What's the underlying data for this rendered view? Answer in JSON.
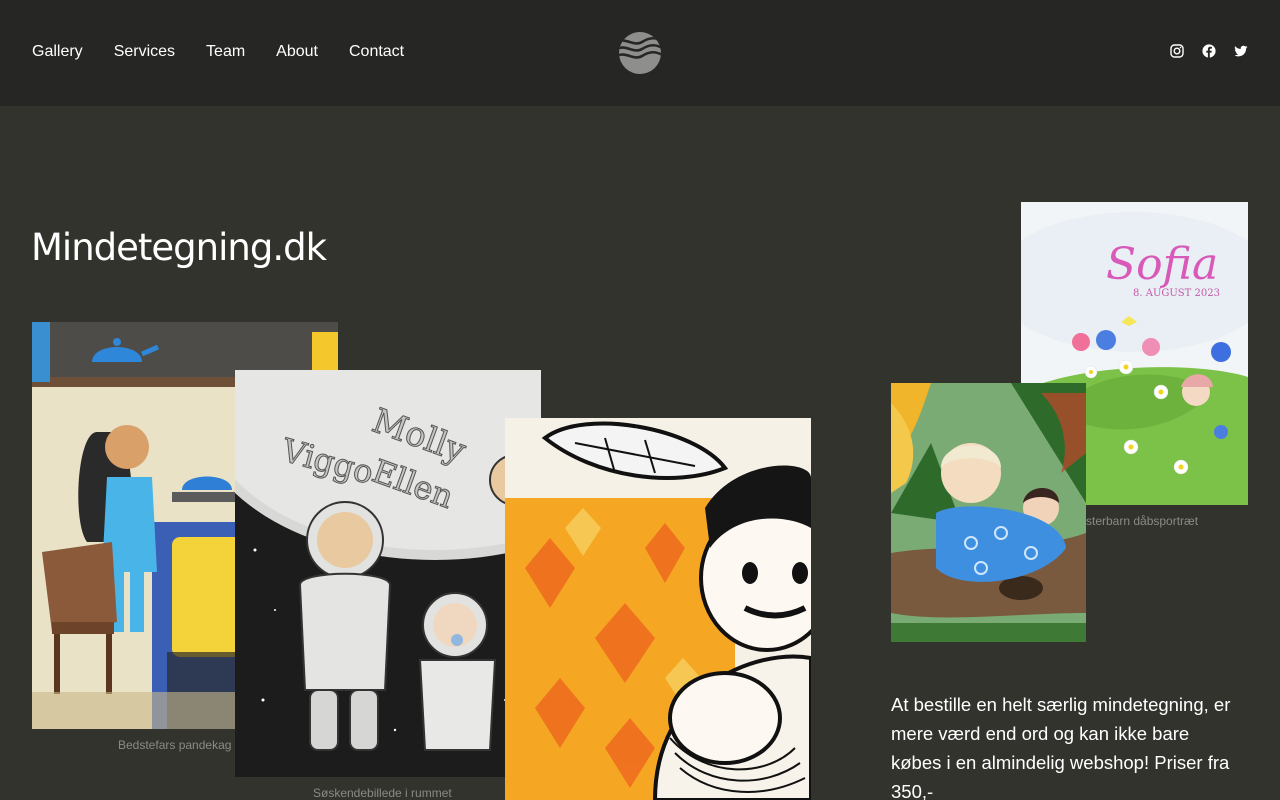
{
  "nav": {
    "items": [
      {
        "label": "Gallery"
      },
      {
        "label": "Services"
      },
      {
        "label": "Team"
      },
      {
        "label": "About"
      },
      {
        "label": "Contact"
      }
    ]
  },
  "logo": {
    "icon": "waves-logo-icon"
  },
  "social": {
    "items": [
      {
        "icon": "instagram-icon"
      },
      {
        "icon": "facebook-icon"
      },
      {
        "icon": "twitter-icon"
      }
    ]
  },
  "site_title": "Mindetegning.dk",
  "gallery": {
    "captions": {
      "kitchen": "Bedstefars pandekag",
      "space": "Søskendebillede i rummet",
      "baptism": "sterbarn dåbsportræt"
    },
    "sofia_artwork": {
      "name": "Sofia",
      "date": "8. AUGUST 2023"
    },
    "space_artwork": {
      "names": [
        "Molly",
        "Viggo",
        "Ellen"
      ]
    }
  },
  "intro_text": "At bestille en helt særlig mindetegning, er mere værd end ord og kan ikke bare købes i en almindelig webshop! Priser fra 350,-",
  "colors": {
    "header_bg": "#262624",
    "page_bg": "#32332d",
    "caption": "#8b8b83"
  }
}
